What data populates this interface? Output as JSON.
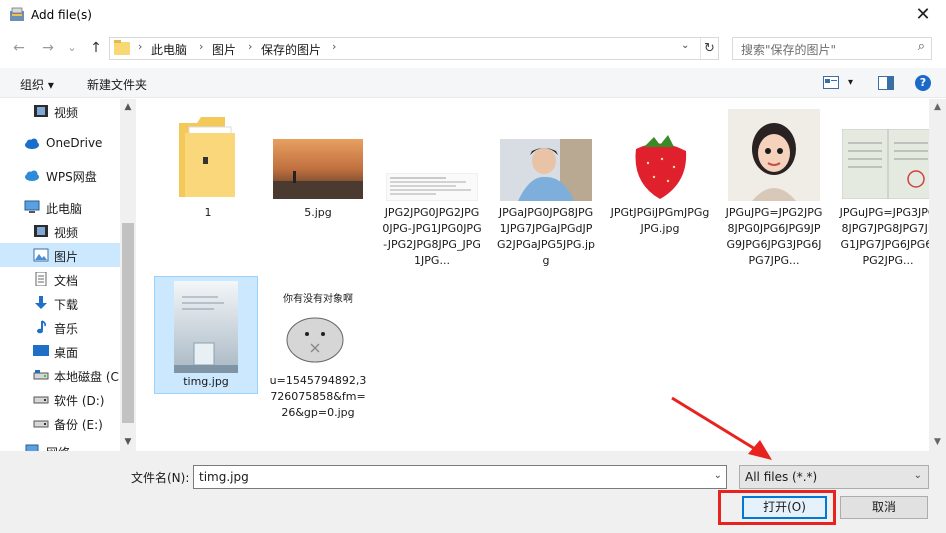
{
  "window": {
    "title": "Add file(s)",
    "close_glyph": "✕"
  },
  "nav": {
    "back": "←",
    "forward": "→",
    "recent": "⌄",
    "up": "↑",
    "breadcrumbs": [
      "此电脑",
      "图片",
      "保存的图片"
    ],
    "crumb_sep": "›",
    "dropdown": "⌄",
    "refresh": "↻",
    "search_placeholder": "搜索\"保存的图片\""
  },
  "toolbar": {
    "organize": "组织 ▾",
    "new_folder": "新建文件夹",
    "view_menu": "▾",
    "help": "?"
  },
  "sidebar": {
    "items": [
      {
        "label": "视频",
        "icon": "video-icon"
      },
      {
        "label": "OneDrive",
        "icon": "cloud-icon"
      },
      {
        "label": "WPS网盘",
        "icon": "cloud-icon"
      },
      {
        "label": "此电脑",
        "icon": "pc-icon"
      },
      {
        "label": "视频",
        "icon": "video-icon"
      },
      {
        "label": "图片",
        "icon": "pictures-icon"
      },
      {
        "label": "文档",
        "icon": "documents-icon"
      },
      {
        "label": "下载",
        "icon": "download-icon"
      },
      {
        "label": "音乐",
        "icon": "music-icon"
      },
      {
        "label": "桌面",
        "icon": "desktop-icon"
      },
      {
        "label": "本地磁盘 (C",
        "icon": "drive-icon"
      },
      {
        "label": "软件 (D:)",
        "icon": "drive-icon"
      },
      {
        "label": "备份 (E:)",
        "icon": "drive-icon"
      },
      {
        "label": "网络",
        "icon": "network-icon"
      }
    ]
  },
  "files": [
    {
      "name": "1",
      "kind": "folder"
    },
    {
      "name": "5.jpg",
      "kind": "sunset"
    },
    {
      "name": "JPG2JPG0JPG2JPG0JPG-JPG1JPG0JPG-JPG2JPG8JPG_JPG1JPG...",
      "kind": "document"
    },
    {
      "name": "JPGaJPG0JPG8JPG1JPG7JPGaJPGdJPG2JPGaJPG5JPG.jpg",
      "kind": "boy"
    },
    {
      "name": "JPGtJPGiJPGmJPGgJPG.jpg",
      "kind": "strawberry"
    },
    {
      "name": "JPGuJPG=JPG2JPG8JPG0JPG6JPG9JPG9JPG6JPG3JPG6JPG7JPG...",
      "kind": "girl"
    },
    {
      "name": "JPGuJPG=JPG3JPG8JPG7JPG8JPG7JPG1JPG7JPG6JPG6JPG2JPG...",
      "kind": "certificate"
    },
    {
      "name": "timg.jpg",
      "kind": "bottle",
      "selected": true
    },
    {
      "name": "u=1545794892,3726075858&fm=26&gp=0.jpg",
      "kind": "hamster",
      "meme_text": "你有没有对象啊"
    }
  ],
  "footer": {
    "filename_label": "文件名(N):",
    "filename_value": "timg.jpg",
    "filetype": "All files (*.*)",
    "open": "打开(O)",
    "cancel": "取消",
    "dropdown": "⌄"
  },
  "colors": {
    "selection": "#cce8ff",
    "accent": "#0078d7",
    "annotation": "#e8231f"
  }
}
